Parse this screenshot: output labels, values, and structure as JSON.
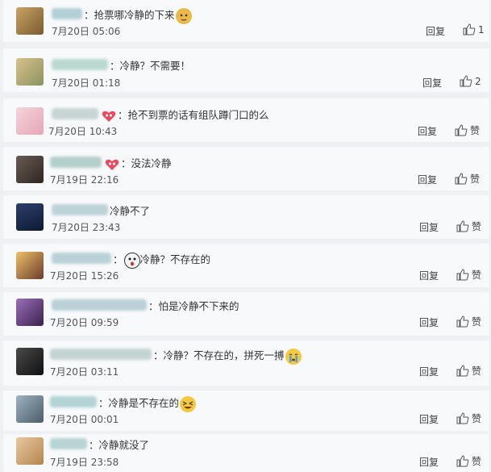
{
  "comments": [
    {
      "sep": "：",
      "text": "抢票哪冷静的下来",
      "date": "7月20日 05:06",
      "reply": "回复",
      "likes": "1"
    },
    {
      "sep": "：",
      "text": "冷静？不需要！",
      "date": "7月20日 01:18",
      "reply": "回复",
      "likes": "2"
    },
    {
      "sep": "：",
      "text": "抢不到票的话有组队蹲门口的么",
      "date": "7月20日 10:43",
      "reply": "回复",
      "likes": "赞"
    },
    {
      "sep": "：",
      "text": "没法冷静",
      "date": "7月19日 22:16",
      "reply": "回复",
      "likes": "赞"
    },
    {
      "sep": "",
      "text": "冷静不了",
      "date": "7月20日 23:43",
      "reply": "回复",
      "likes": "赞"
    },
    {
      "sep": "：",
      "text": "冷静？不存在的",
      "date": "7月20日 15:26",
      "reply": "回复",
      "likes": "赞"
    },
    {
      "sep": "：",
      "text": "怕是冷静不下来的",
      "date": "7月20日 09:59",
      "reply": "回复",
      "likes": "赞"
    },
    {
      "sep": "：",
      "text": "冷静？不存在的，拼死一搏",
      "date": "7月20日 03:11",
      "reply": "回复",
      "likes": "赞"
    },
    {
      "sep": "：",
      "text": "冷静是不存在的",
      "date": "7月20日 00:01",
      "reply": "回复",
      "likes": "赞"
    },
    {
      "sep": "：",
      "text": "冷静就没了",
      "date": "7月19日 23:58",
      "reply": "回复",
      "likes": "赞"
    }
  ],
  "colors": {
    "name_blur": "#9bc3c9",
    "text": "#333333",
    "background": "#eef0f3"
  }
}
